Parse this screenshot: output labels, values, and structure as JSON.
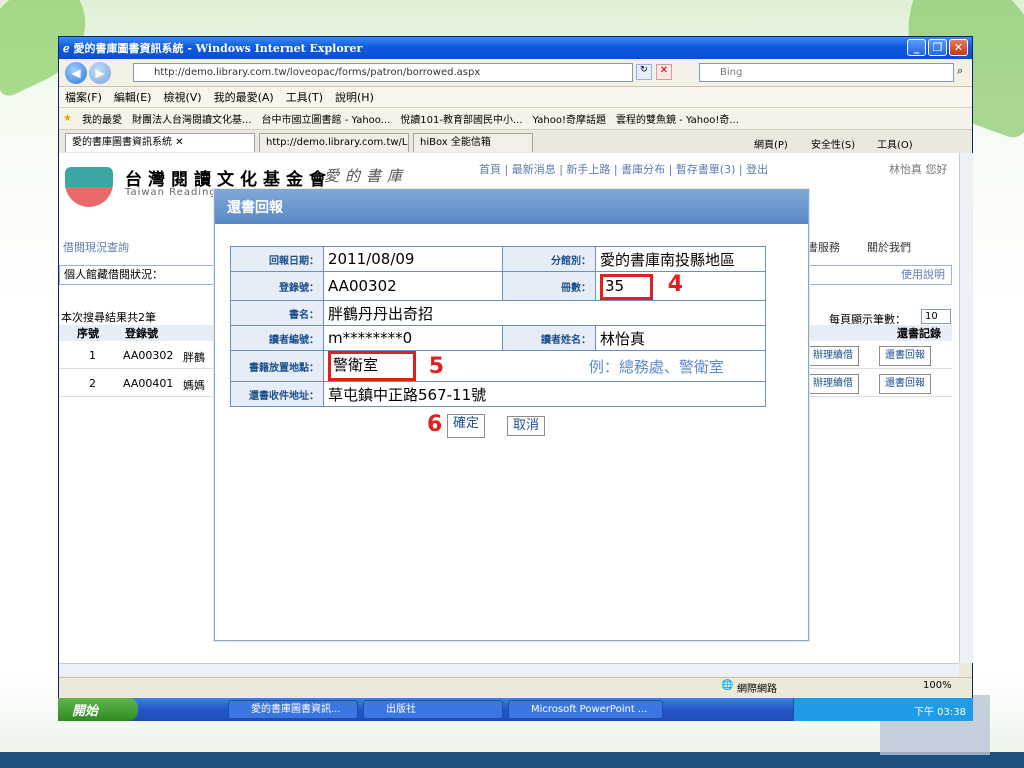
{
  "window": {
    "title": "愛的書庫圖書資訊系統 - Windows Internet Explorer"
  },
  "address": {
    "url": "http://demo.library.com.tw/loveopac/forms/patron/borrowed.aspx",
    "search_placeholder": "Bing"
  },
  "menu": [
    "檔案(F)",
    "編輯(E)",
    "檢視(V)",
    "我的最愛(A)",
    "工具(T)",
    "說明(H)"
  ],
  "favorites": {
    "label": "我的最愛",
    "items": [
      "財團法人台灣閱讀文化基...",
      "台中市國立圖書館 - Yahoo...",
      "悅讀101-教育部國民中小...",
      "Yahoo!奇摩話題",
      "雲程的雙魚鏡 - Yahoo!奇..."
    ]
  },
  "tabs": {
    "items": [
      "愛的書庫圖書資訊系統",
      "http://demo.library.com.tw/Lo...",
      "hiBox 全能信箱"
    ],
    "toolbar": [
      "網頁(P)",
      "安全性(S)",
      "工具(O)"
    ]
  },
  "site": {
    "logo_title": "台灣閱讀文化基金會",
    "logo_subtitle": "Taiwan Reading",
    "logo_tail": "愛的書庫",
    "top_links": [
      "首頁",
      "最新消息",
      "新手上路",
      "書庫分布",
      "暫存書單(3)",
      "登出"
    ],
    "user": "林怡真 您好",
    "side_links": [
      "借閱現況查詢",
      "書服務",
      "關於我們"
    ],
    "status_label": "個人館藏借閱狀況：",
    "help": "使用說明",
    "result": "本次搜尋結果共2筆",
    "per_page_label": "每頁顯示筆數：",
    "per_page_value": "10",
    "cols": [
      "序號",
      "登錄號",
      "還書記錄"
    ],
    "rows": [
      {
        "no": "1",
        "id": "AA00302",
        "title": "胖鶴",
        "a": "辦理續借",
        "b": "還書回報"
      },
      {
        "no": "2",
        "id": "AA00401",
        "title": "媽媽",
        "a": "辦理續借",
        "b": "還書回報"
      }
    ]
  },
  "dialog": {
    "title": "還書回報",
    "labels": {
      "date": "回報日期：",
      "branch": "分館別：",
      "reg": "登錄號：",
      "vol": "冊數：",
      "book": "書名：",
      "reader_id": "讀者編號：",
      "reader_name": "讀者姓名：",
      "place": "書籍放置地點：",
      "addr": "還書收件地址："
    },
    "values": {
      "date": "2011/08/09",
      "branch": "愛的書庫南投縣地區",
      "reg": "AA00302",
      "vol": "35",
      "book": "胖鶴丹丹出奇招",
      "reader_id": "m********0",
      "reader_name": "林怡真",
      "place": "警衛室",
      "place_hint": "例：總務處、警衛室",
      "addr": "草屯鎮中正路567-11號"
    },
    "ok": "確定",
    "cancel": "取消",
    "markers": {
      "vol": "4",
      "place": "5",
      "ok": "6"
    }
  },
  "status": {
    "zone": "網際網路",
    "zoom": "100%"
  },
  "taskbar": {
    "start": "開始",
    "tasks": [
      "愛的書庫圖書資訊...",
      "出版社",
      "Microsoft PowerPoint ..."
    ],
    "time": "下午 03:38"
  },
  "colors": {
    "titlebar": "#0f5be0",
    "taskbar": "#2357c9",
    "marker": "#e02020",
    "link": "#5b7bb0"
  }
}
